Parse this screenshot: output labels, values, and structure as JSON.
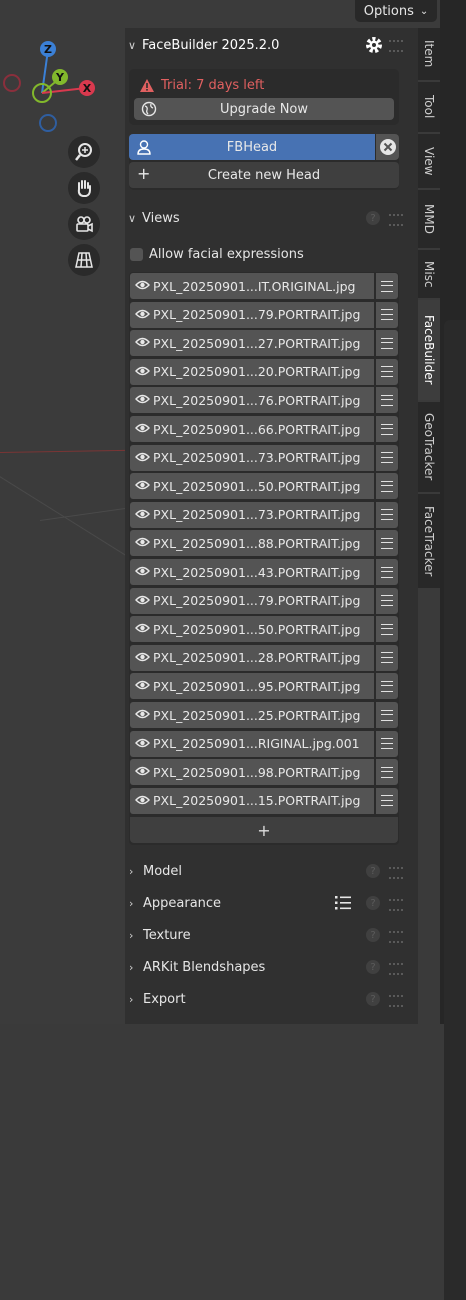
{
  "options_label": "Options",
  "gizmo_axes": {
    "z": "Z",
    "y": "Y",
    "x": "X"
  },
  "side_tabs": [
    "Item",
    "Tool",
    "View",
    "MMD",
    "Misc",
    "FaceBuilder",
    "GeoTracker",
    "FaceTracker"
  ],
  "active_tab": "FaceBuilder",
  "panel": {
    "title": "FaceBuilder 2025.2.0",
    "trial_text": "Trial: 7 days left",
    "upgrade_label": "Upgrade Now",
    "head_name": "FBHead",
    "create_head_label": "Create new Head",
    "create_head_plus": "+",
    "views_label": "Views",
    "allow_expressions_label": "Allow facial expressions",
    "add_view": "+",
    "help_glyph": "?",
    "views": [
      "PXL_20250901...IT.ORIGINAL.jpg",
      "PXL_20250901...79.PORTRAIT.jpg",
      "PXL_20250901...27.PORTRAIT.jpg",
      "PXL_20250901...20.PORTRAIT.jpg",
      "PXL_20250901...76.PORTRAIT.jpg",
      "PXL_20250901...66.PORTRAIT.jpg",
      "PXL_20250901...73.PORTRAIT.jpg",
      "PXL_20250901...50.PORTRAIT.jpg",
      "PXL_20250901...73.PORTRAIT.jpg",
      "PXL_20250901...88.PORTRAIT.jpg",
      "PXL_20250901...43.PORTRAIT.jpg",
      "PXL_20250901...79.PORTRAIT.jpg",
      "PXL_20250901...50.PORTRAIT.jpg",
      "PXL_20250901...28.PORTRAIT.jpg",
      "PXL_20250901...95.PORTRAIT.jpg",
      "PXL_20250901...25.PORTRAIT.jpg",
      "PXL_20250901...RIGINAL.jpg.001",
      "PXL_20250901...98.PORTRAIT.jpg",
      "PXL_20250901...15.PORTRAIT.jpg"
    ],
    "sections": [
      "Model",
      "Appearance",
      "Texture",
      "ARKit Blendshapes",
      "Export"
    ]
  },
  "colors": {
    "accent_blue": "#4772b3",
    "trial_red": "#e06060",
    "axis_x": "#d9394e",
    "axis_y": "#82b82c",
    "axis_z": "#3b80d6"
  },
  "icons": {
    "settings": "gear-icon",
    "warning": "warning-icon",
    "upgrade": "globe-icon",
    "head": "user-icon",
    "remove_head": "close-icon",
    "view_visible": "eye-icon",
    "view_menu": "hamburger-icon"
  }
}
